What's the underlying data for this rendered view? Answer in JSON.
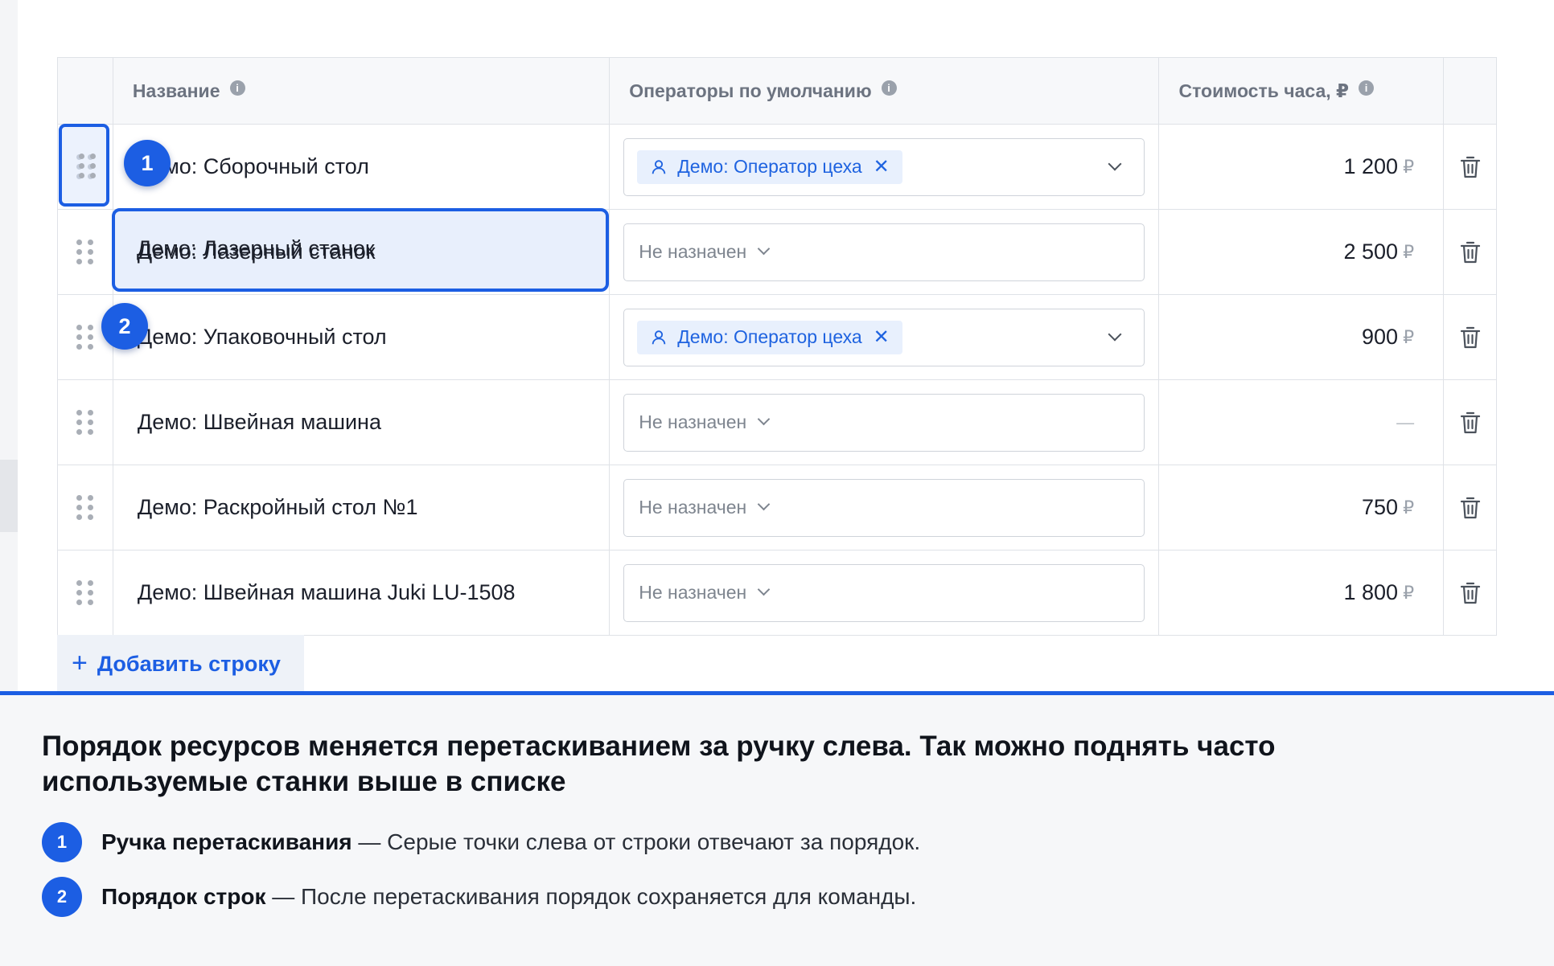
{
  "table": {
    "headers": {
      "name": "Название",
      "operators": "Операторы по умолчанию",
      "cost": "Стоимость часа, ₽"
    },
    "rows": [
      {
        "name": "Демо: Сборочный стол",
        "operator": "Демо: Оператор цеха",
        "cost": "1 200",
        "currency": "₽"
      },
      {
        "name": "Демо: Лазерный станок",
        "operator_placeholder": "Не назначен",
        "cost": "2 500",
        "currency": "₽"
      },
      {
        "name": "Демо: Упаковочный стол",
        "operator": "Демо: Оператор цеха",
        "cost": "900",
        "currency": "₽"
      },
      {
        "name": "Демо: Швейная машина",
        "operator_placeholder": "Не назначен",
        "cost": "—"
      },
      {
        "name": "Демо: Раскройный стол №1",
        "operator_placeholder": "Не назначен",
        "cost": "750",
        "currency": "₽"
      },
      {
        "name": "Демо: Швейная машина Juki LU-1508",
        "operator_placeholder": "Не назначен",
        "cost": "1 800",
        "currency": "₽"
      }
    ],
    "add_row_label": "Добавить строку"
  },
  "callouts": {
    "one": "1",
    "two": "2"
  },
  "panel": {
    "title": "Порядок ресурсов меняется перетаскиванием за ручку слева. Так можно поднять часто используемые станки выше в списке",
    "items": [
      {
        "num": "1",
        "term": "Ручка перетаскивания",
        "desc": " — Серые точки слева от строки отвечают за порядок."
      },
      {
        "num": "2",
        "term": "Порядок строк",
        "desc": " — После перетаскивания порядок сохраняется для команды."
      }
    ]
  },
  "colors": {
    "accent": "#1c5ee3",
    "tag_bg": "#e8f0fd"
  },
  "icons": [
    "drag-handle-icon",
    "info-icon",
    "user-icon",
    "chevron-down-icon",
    "close-icon",
    "trash-icon",
    "plus-icon"
  ]
}
